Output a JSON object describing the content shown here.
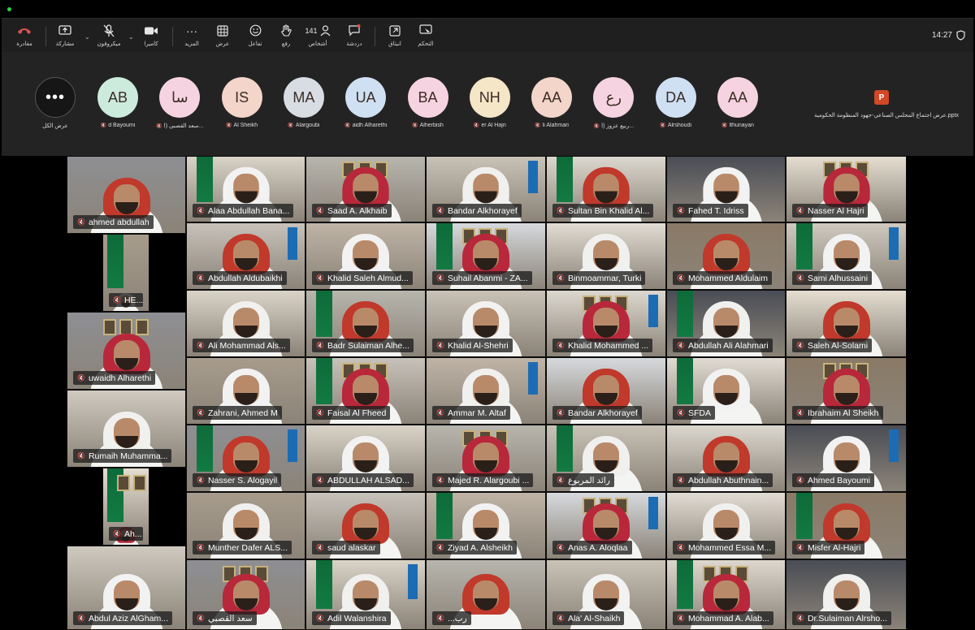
{
  "toolbar": {
    "leave": "مغادرة",
    "share": "مشاركة",
    "mic": "ميكروفون",
    "camera": "كاميرا",
    "more": "المزيد",
    "view": "عرض",
    "react": "تفاعل",
    "raise": "رفع",
    "people_count": "141",
    "people": "أشخاص",
    "chat": "دردشة",
    "apps": "انبثاق",
    "control": "التحكم",
    "time": "14:27"
  },
  "colors": {
    "leave": "#e0534e",
    "accent_bg": "#1f1f1f",
    "strip_bg": "#232323",
    "avatar_peach": "#f3d5c9",
    "avatar_mint": "#cdebdc",
    "avatar_blue": "#cfe0f3",
    "avatar_grey": "#d8dde3",
    "avatar_pink": "#f6d3e0",
    "avatar_cream": "#f5e6c8"
  },
  "strip": {
    "more_label": "عرض الكل",
    "participants": [
      {
        "initials": "AB",
        "name": "d Bayoumi"
      },
      {
        "initials": "سا",
        "name": "سعد القصبي (ا..."
      },
      {
        "initials": "IS",
        "name": "Al Sheikh"
      },
      {
        "initials": "MA",
        "name": "Alargoubi"
      },
      {
        "initials": "UA",
        "name": "aidh Alharethi"
      },
      {
        "initials": "BA",
        "name": "Alherbish"
      },
      {
        "initials": "NH",
        "name": "er Al Hajri"
      },
      {
        "initials": "AA",
        "name": "li Alahmari"
      },
      {
        "initials": "رع",
        "name": "ربيع عزوز (ا..."
      },
      {
        "initials": "DA",
        "name": "Alrshoudi"
      },
      {
        "initials": "AA",
        "name": "lthunayan"
      }
    ],
    "file_name": "عرض اجتماع المجلس الصناعي-جهود المنظومة الحكومية.pptx"
  },
  "tiles": [
    {
      "name": "ahmed abdullah"
    },
    {
      "name": "Alaa Abdullah Bana..."
    },
    {
      "name": "Saad A. Alkhaib"
    },
    {
      "name": "Bandar Alkhorayef"
    },
    {
      "name": "Sultan Bin Khalid Al..."
    },
    {
      "name": "Fahed T. Idriss"
    },
    {
      "name": "Nasser Al Hajri"
    },
    {
      "name": "HE..."
    },
    {
      "name": "Abdullah Aldubaikhi"
    },
    {
      "name": "Khalid Saleh Almud..."
    },
    {
      "name": "Suhail Abanmi - ZA..."
    },
    {
      "name": "Binmoammar, Turki"
    },
    {
      "name": "Mohammed Aldulaim"
    },
    {
      "name": "Sami Alhussaini"
    },
    {
      "name": "uwaidh Alharethi"
    },
    {
      "name": "Ali Mohammad Als..."
    },
    {
      "name": "Badr Sulaiman Alhe..."
    },
    {
      "name": "Khalid Al-Shehri"
    },
    {
      "name": "Khalid Mohammed ..."
    },
    {
      "name": "Abdullah Ali Alahmari"
    },
    {
      "name": "Saleh Al-Solami"
    },
    {
      "name": "Zahrani, Ahmed M"
    },
    {
      "name": "Faisal Al Fheed"
    },
    {
      "name": "Ammar M. Altaf"
    },
    {
      "name": "Bandar Alkhorayef"
    },
    {
      "name": "SFDA"
    },
    {
      "name": "Ibrahaim Al Sheikh"
    },
    {
      "name": "Rumaih Muhamma..."
    },
    {
      "name": "Nasser S. Alogayil"
    },
    {
      "name": "ABDULLAH ALSAD..."
    },
    {
      "name": "Majed R. Alargoubi ..."
    },
    {
      "name": "رائد المربوع"
    },
    {
      "name": "Abdullah Abuthnain..."
    },
    {
      "name": "Ahmed Bayoumi"
    },
    {
      "name": "Ah..."
    },
    {
      "name": "Munther Dafer ALS..."
    },
    {
      "name": "saud alaskar"
    },
    {
      "name": "Ziyad A. Alsheikh"
    },
    {
      "name": "Anas A. Aloqlaa"
    },
    {
      "name": "Mohammed Essa M..."
    },
    {
      "name": "Misfer Al-Hajri"
    },
    {
      "name": "Abdul Aziz AlGham..."
    },
    {
      "name": "سعد القصبي"
    },
    {
      "name": "Adil Walanshira"
    },
    {
      "name": "...رب"
    },
    {
      "name": "Ala' Al-Shaikh"
    },
    {
      "name": "Mohammad A. Alab..."
    },
    {
      "name": "Dr.Sulaiman Alrsho..."
    }
  ]
}
